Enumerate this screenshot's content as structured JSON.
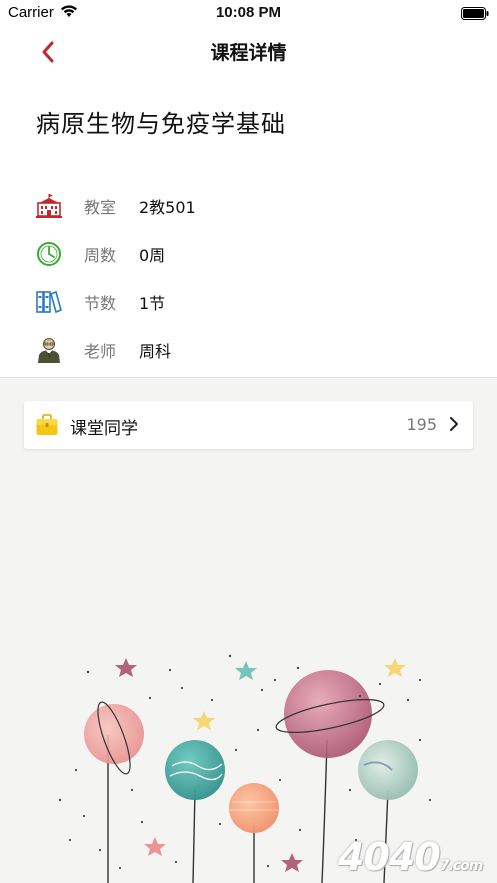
{
  "status_bar": {
    "carrier": "Carrier",
    "time": "10:08 PM"
  },
  "nav": {
    "title": "课程详情",
    "back_icon": "chevron-left-icon"
  },
  "course": {
    "title": "病原生物与免疫学基础"
  },
  "info": [
    {
      "icon": "building-icon",
      "label": "教室",
      "value": "2教501"
    },
    {
      "icon": "clock-icon",
      "label": "周数",
      "value": "0周"
    },
    {
      "icon": "books-icon",
      "label": "节数",
      "value": "1节"
    },
    {
      "icon": "teacher-icon",
      "label": "老师",
      "value": "周科"
    }
  ],
  "classmates": {
    "label": "课堂同学",
    "count": "195",
    "icon": "briefcase-icon"
  },
  "watermark": {
    "text": "4040",
    "suffix": "7.com"
  },
  "colors": {
    "accent_red": "#c0282d",
    "clock_green": "#3aaa35",
    "books_blue": "#2b7bbf",
    "bag_yellow": "#f5c518"
  }
}
